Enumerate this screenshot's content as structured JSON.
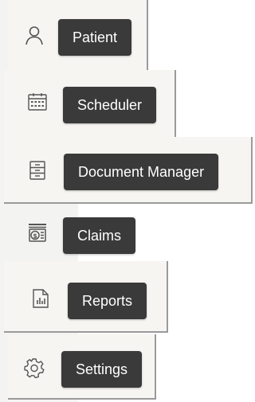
{
  "nav": {
    "items": [
      {
        "key": "patient",
        "label": "Patient",
        "icon": "user-icon"
      },
      {
        "key": "scheduler",
        "label": "Scheduler",
        "icon": "calendar-icon"
      },
      {
        "key": "document-manager",
        "label": "Document Manager",
        "icon": "file-cabinet-icon"
      },
      {
        "key": "claims",
        "label": "Claims",
        "icon": "claims-dollar-icon"
      },
      {
        "key": "reports",
        "label": "Reports",
        "icon": "report-chart-icon"
      },
      {
        "key": "settings",
        "label": "Settings",
        "icon": "gear-icon"
      }
    ]
  },
  "colors": {
    "tooltip_bg": "#3a3a3a",
    "tooltip_text": "#ffffff",
    "sidebar_bg": "#f3f3f2",
    "icon_stroke": "#555555",
    "panel_bg": "#f7f5f2"
  }
}
